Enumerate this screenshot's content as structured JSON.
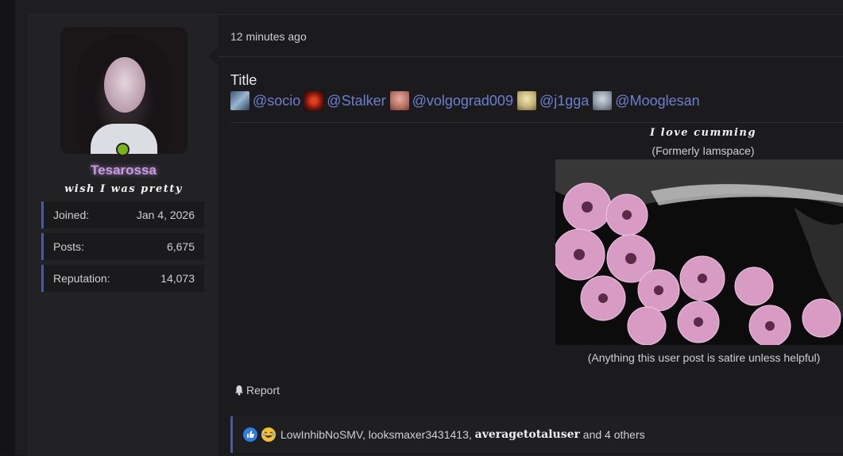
{
  "post": {
    "time": "12 minutes ago",
    "title": "Title",
    "mentions": [
      {
        "name": "@socio",
        "color": "#6a8fb0"
      },
      {
        "name": "@Stalker",
        "color": "#c0301c"
      },
      {
        "name": "@volgograd009",
        "color": "#c98a7c"
      },
      {
        "name": "@j1gga",
        "color": "#c9b97f"
      },
      {
        "name": "@Mooglesan",
        "color": "#8c9aa6"
      }
    ]
  },
  "user": {
    "name": "Tesarossa",
    "title": "wish I was pretty",
    "online": true,
    "stats": [
      {
        "label": "Joined:",
        "value": "Jan 4, 2026"
      },
      {
        "label": "Posts:",
        "value": "6,675"
      },
      {
        "label": "Reputation:",
        "value": "14,073"
      }
    ]
  },
  "signature": {
    "title": "I love cumming",
    "subtitle": "(Formerly Iamspace)",
    "caption": "(Anything this user post is satire unless helpful)"
  },
  "actions": {
    "report": "Report"
  },
  "reactions": {
    "users": "LowInhibNoSMV, looksmaxer3431413,",
    "bold_user": "averagetotaluser",
    "others": "and 4 others"
  },
  "colors": {
    "accent": "#4a5a9a",
    "mention": "#6b7fcf",
    "online": "#78b51a",
    "username": "#c79be0"
  }
}
